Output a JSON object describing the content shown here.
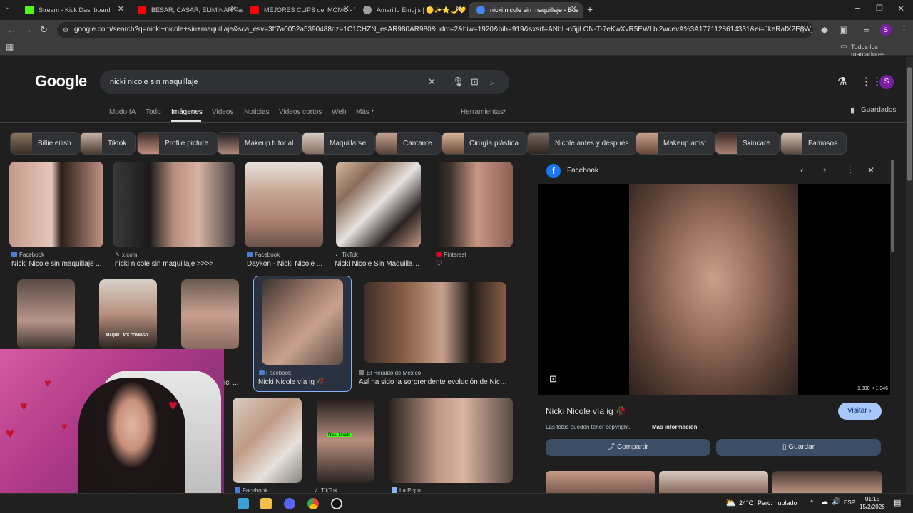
{
  "browser": {
    "tabs": [
      {
        "label": "Stream - Kick Dashboard",
        "color": "#53fc18"
      },
      {
        "label": "BESAR, CASAR, ELIMINAR Famo",
        "color": "#ff0000"
      },
      {
        "label": "MEJORES CLIPS del MOMO - Yo",
        "color": "#ff0000"
      },
      {
        "label": "Amarillo Emojis | 🟡✨⭐🌙💛",
        "color": "#9e9e9e"
      },
      {
        "label": "nicki nicole sin maquillaje - Bus",
        "color": "#4285f4"
      }
    ],
    "url": "google.com/search?q=nicki+nicole+sin+maquillaje&sca_esv=3ff7a0052a5390488rlz=1C1CHZN_esAR980AR980&udm=2&biw=1920&bih=919&sxsrf=ANbL-n5jjLON-T-7eKwXvR5EWLbi2wcevA%3A1771128614331&ei=JkeRafX2E8W_5OUPuej...",
    "bookmarks_label": "Todos los marcadores",
    "profile_initial": "S"
  },
  "google": {
    "logo": "Google",
    "query": "nicki nicole sin maquillaje",
    "nav": [
      "Modo IA",
      "Todo",
      "Imágenes",
      "Videos",
      "Noticias",
      "Videos cortos",
      "Web",
      "Más"
    ],
    "active_nav": "Imágenes",
    "tools_label": "Herramientas",
    "saved_label": "Guardados",
    "chips": [
      "Billie eilish",
      "Tiktok",
      "Profile picture",
      "Makeup tutorial",
      "Maquillarse",
      "Cantante",
      "Cirugía plástica",
      "Nicole antes y después",
      "Makeup artist",
      "Skincare",
      "Famosos"
    ],
    "results": [
      {
        "source": "Facebook",
        "title": "Nicki Nicole sin maquillaje ..."
      },
      {
        "source": "x.com",
        "title": "nicki nicole sin maquillaje >>>>"
      },
      {
        "source": "Facebook",
        "title": "Daykon - Nicki Nicole ..."
      },
      {
        "source": "TikTok",
        "title": "Nicki Nicole Sin Maquillaje..."
      },
      {
        "source": "Pinterest",
        "title": "♡"
      },
      {
        "source": "Facebook",
        "title": "Nicki Nicole vía ig 🥀"
      },
      {
        "source": "El Heraldo de México",
        "title": "Así ha sido la sorprendente evolución de Nicki ..."
      },
      {
        "source": "Facebook",
        "title": ""
      },
      {
        "source": "TikTok",
        "title": ""
      },
      {
        "source": "La Popu",
        "title": ""
      }
    ],
    "row2_partial_caption": "ici ...",
    "thumb_texts": [
      "MAQUILLATE CONMIGO",
      "Nicki Nicole"
    ]
  },
  "panel": {
    "source": "Facebook",
    "dimensions": "1.080 × 1.346",
    "title": "Nicki Nicole vía ig 🥀",
    "visit_label": "Visitar",
    "copyright_note": "Las fotos pueden tener copyright.",
    "more_info": "Más información",
    "share_label": "Compartir",
    "save_label": "Guardar"
  },
  "taskbar": {
    "weather": "24°C",
    "weather_desc": "Parc. nublado",
    "lang": "ESP",
    "time": "01:15",
    "date": "15/2/2026"
  }
}
